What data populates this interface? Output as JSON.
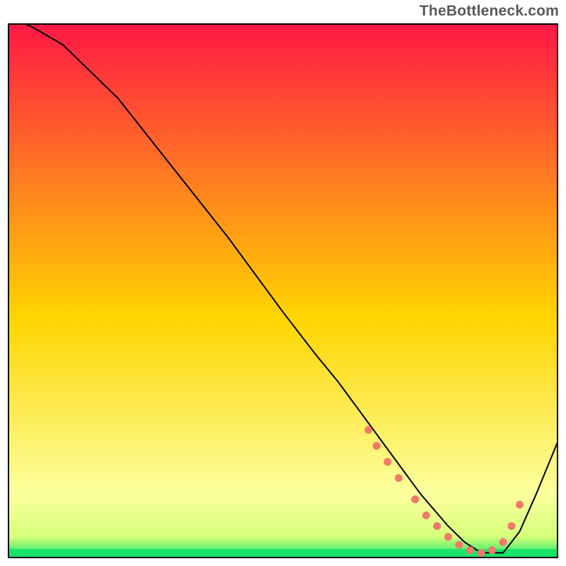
{
  "watermark": "TheBottleneck.com",
  "colors": {
    "grad_top": "#ff1846",
    "grad_mid": "#ffd500",
    "grad_low": "#fcff9e",
    "grad_green": "#18e46a",
    "border": "#000000",
    "line": "#000000",
    "dot": "#ef7a6a"
  },
  "chart_data": {
    "type": "line",
    "title": "",
    "xlabel": "",
    "ylabel": "",
    "xlim": [
      0,
      100
    ],
    "ylim": [
      0,
      100
    ],
    "series": [
      {
        "name": "curve",
        "x": [
          3,
          5,
          10,
          20,
          30,
          40,
          50,
          56,
          60,
          65,
          70,
          75,
          80,
          83,
          86,
          90,
          93,
          96,
          100
        ],
        "y": [
          100,
          99,
          96,
          86,
          73,
          60,
          46,
          38,
          33,
          26,
          19,
          12,
          6,
          3,
          1,
          1,
          5,
          12,
          22
        ]
      }
    ],
    "dotted_region_x": [
      65,
      93
    ],
    "dots": [
      {
        "x": 65.5,
        "y": 24
      },
      {
        "x": 67,
        "y": 21
      },
      {
        "x": 69,
        "y": 18
      },
      {
        "x": 71,
        "y": 15
      },
      {
        "x": 74,
        "y": 11
      },
      {
        "x": 76,
        "y": 8
      },
      {
        "x": 78,
        "y": 6
      },
      {
        "x": 80,
        "y": 4
      },
      {
        "x": 82,
        "y": 2.5
      },
      {
        "x": 84,
        "y": 1.5
      },
      {
        "x": 86,
        "y": 1
      },
      {
        "x": 88,
        "y": 1.5
      },
      {
        "x": 90,
        "y": 3
      },
      {
        "x": 91.5,
        "y": 6
      },
      {
        "x": 93,
        "y": 10
      }
    ]
  }
}
